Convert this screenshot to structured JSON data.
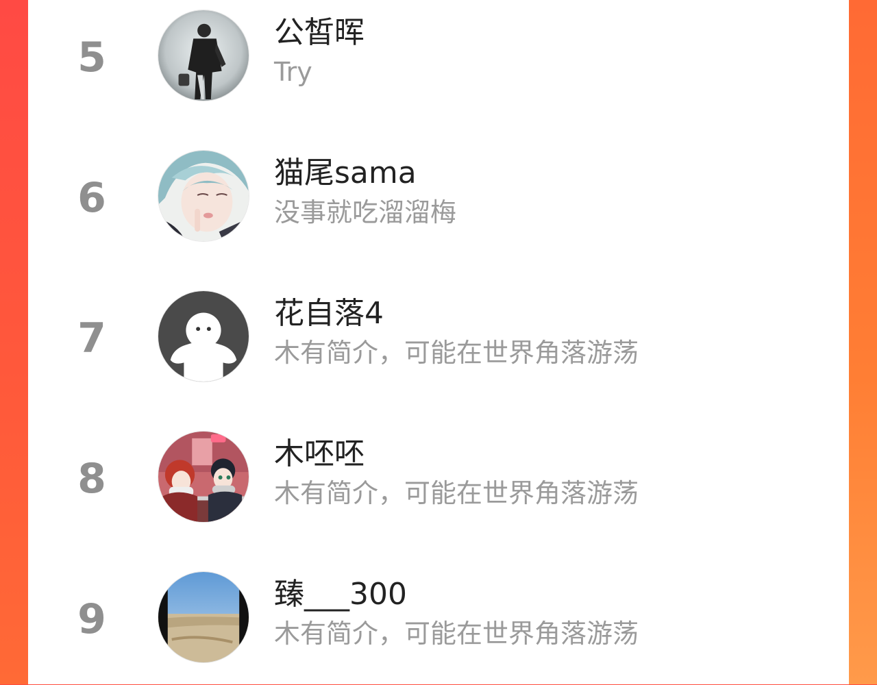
{
  "colors": {
    "accent_gradient_top": "#ff4a3d",
    "accent_gradient_bottom": "#ff8a3a",
    "rank_color": "#8f8f8f",
    "name_color": "#222222",
    "bio_color": "#9a9a9a"
  },
  "list": {
    "items": [
      {
        "rank": "5",
        "name": "公皙晖",
        "bio": "Try",
        "avatar_icon": "avatar-photo-figure"
      },
      {
        "rank": "6",
        "name": "猫尾sama",
        "bio": "没事就吃溜溜梅",
        "avatar_icon": "avatar-anime-character"
      },
      {
        "rank": "7",
        "name": "花自落4",
        "bio": "木有简介，可能在世界角落游荡",
        "avatar_icon": "avatar-default-ghost"
      },
      {
        "rank": "8",
        "name": "木呸呸",
        "bio": "木有简介，可能在世界角落游荡",
        "avatar_icon": "avatar-comic-couple"
      },
      {
        "rank": "9",
        "name": "臻___300",
        "bio": "木有简介，可能在世界角落游荡",
        "avatar_icon": "avatar-desert-landscape"
      }
    ]
  }
}
